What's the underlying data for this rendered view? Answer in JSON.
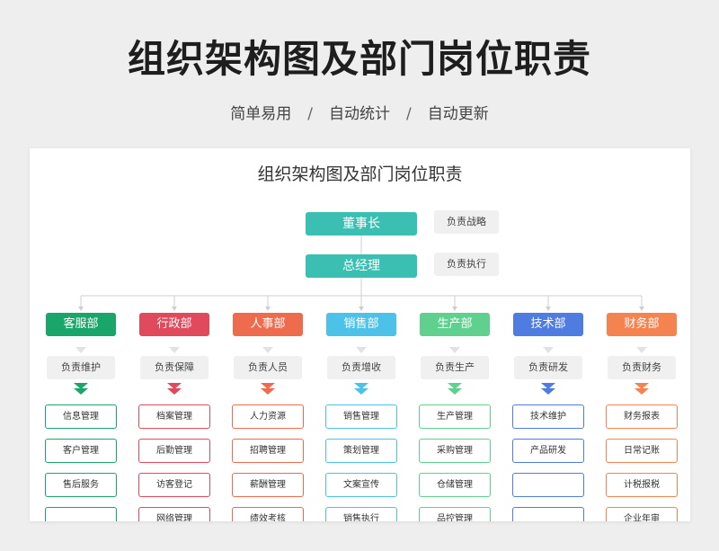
{
  "header": {
    "title": "组织架构图及部门岗位职责",
    "subtitle_items": [
      "简单易用",
      "自动统计",
      "自动更新"
    ],
    "separator": "/"
  },
  "chart": {
    "title": "组织架构图及部门岗位职责",
    "top": [
      {
        "label": "董事长",
        "duty": "负责战略"
      },
      {
        "label": "总经理",
        "duty": "负责执行"
      }
    ],
    "departments": [
      {
        "name": "客服部",
        "color": "#1aa56b",
        "duty": "负责维护",
        "items": [
          "信息管理",
          "客户管理",
          "售后服务",
          ""
        ]
      },
      {
        "name": "行政部",
        "color": "#e04a5c",
        "duty": "负责保障",
        "items": [
          "档案管理",
          "后勤管理",
          "访客登记",
          "网络管理"
        ]
      },
      {
        "name": "人事部",
        "color": "#ee6c4d",
        "duty": "负责人员",
        "items": [
          "人力资源",
          "招聘管理",
          "薪酬管理",
          "绩效考核"
        ]
      },
      {
        "name": "销售部",
        "color": "#4dc2e8",
        "duty": "负责增收",
        "items": [
          "销售管理",
          "策划管理",
          "文案宣传",
          "销售执行"
        ]
      },
      {
        "name": "生产部",
        "color": "#5fd08e",
        "duty": "负责生产",
        "items": [
          "生产管理",
          "采购管理",
          "仓储管理",
          "品控管理"
        ]
      },
      {
        "name": "技术部",
        "color": "#4f7ce0",
        "duty": "负责研发",
        "items": [
          "技术维护",
          "产品研发",
          "",
          ""
        ]
      },
      {
        "name": "财务部",
        "color": "#f5834f",
        "duty": "负责财务",
        "items": [
          "财务报表",
          "日常记账",
          "计税报税",
          "企业年审"
        ]
      }
    ]
  }
}
